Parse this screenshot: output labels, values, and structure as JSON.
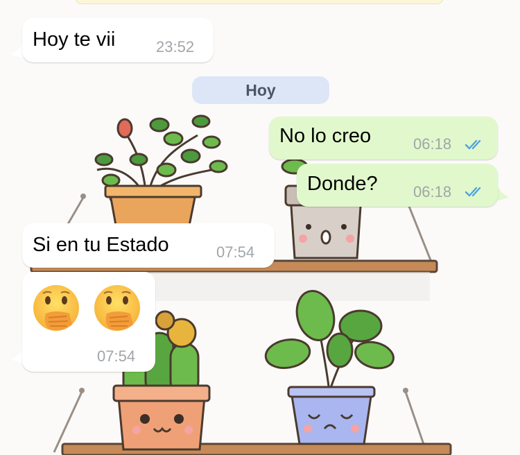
{
  "chat": {
    "date_separator": "Hoy",
    "messages": [
      {
        "direction": "in",
        "text": "Hoy te vii",
        "time": "23:52"
      },
      {
        "direction": "out",
        "text": "No lo creo",
        "time": "06:18",
        "status": "read"
      },
      {
        "direction": "out",
        "text": "Donde?",
        "time": "06:18",
        "status": "read"
      },
      {
        "direction": "in",
        "text": "Si en tu Estado",
        "time": "07:54"
      },
      {
        "direction": "in",
        "emojis": [
          "face-with-hand-over-mouth",
          "face-with-hand-over-mouth"
        ],
        "time": "07:54"
      }
    ]
  },
  "colors": {
    "incoming_bubble": "#ffffff",
    "outgoing_bubble": "#e1f8cc",
    "read_ticks": "#4fa3e0",
    "date_pill": "#dde6f7"
  },
  "wallpaper": "potted-plants-on-shelves"
}
